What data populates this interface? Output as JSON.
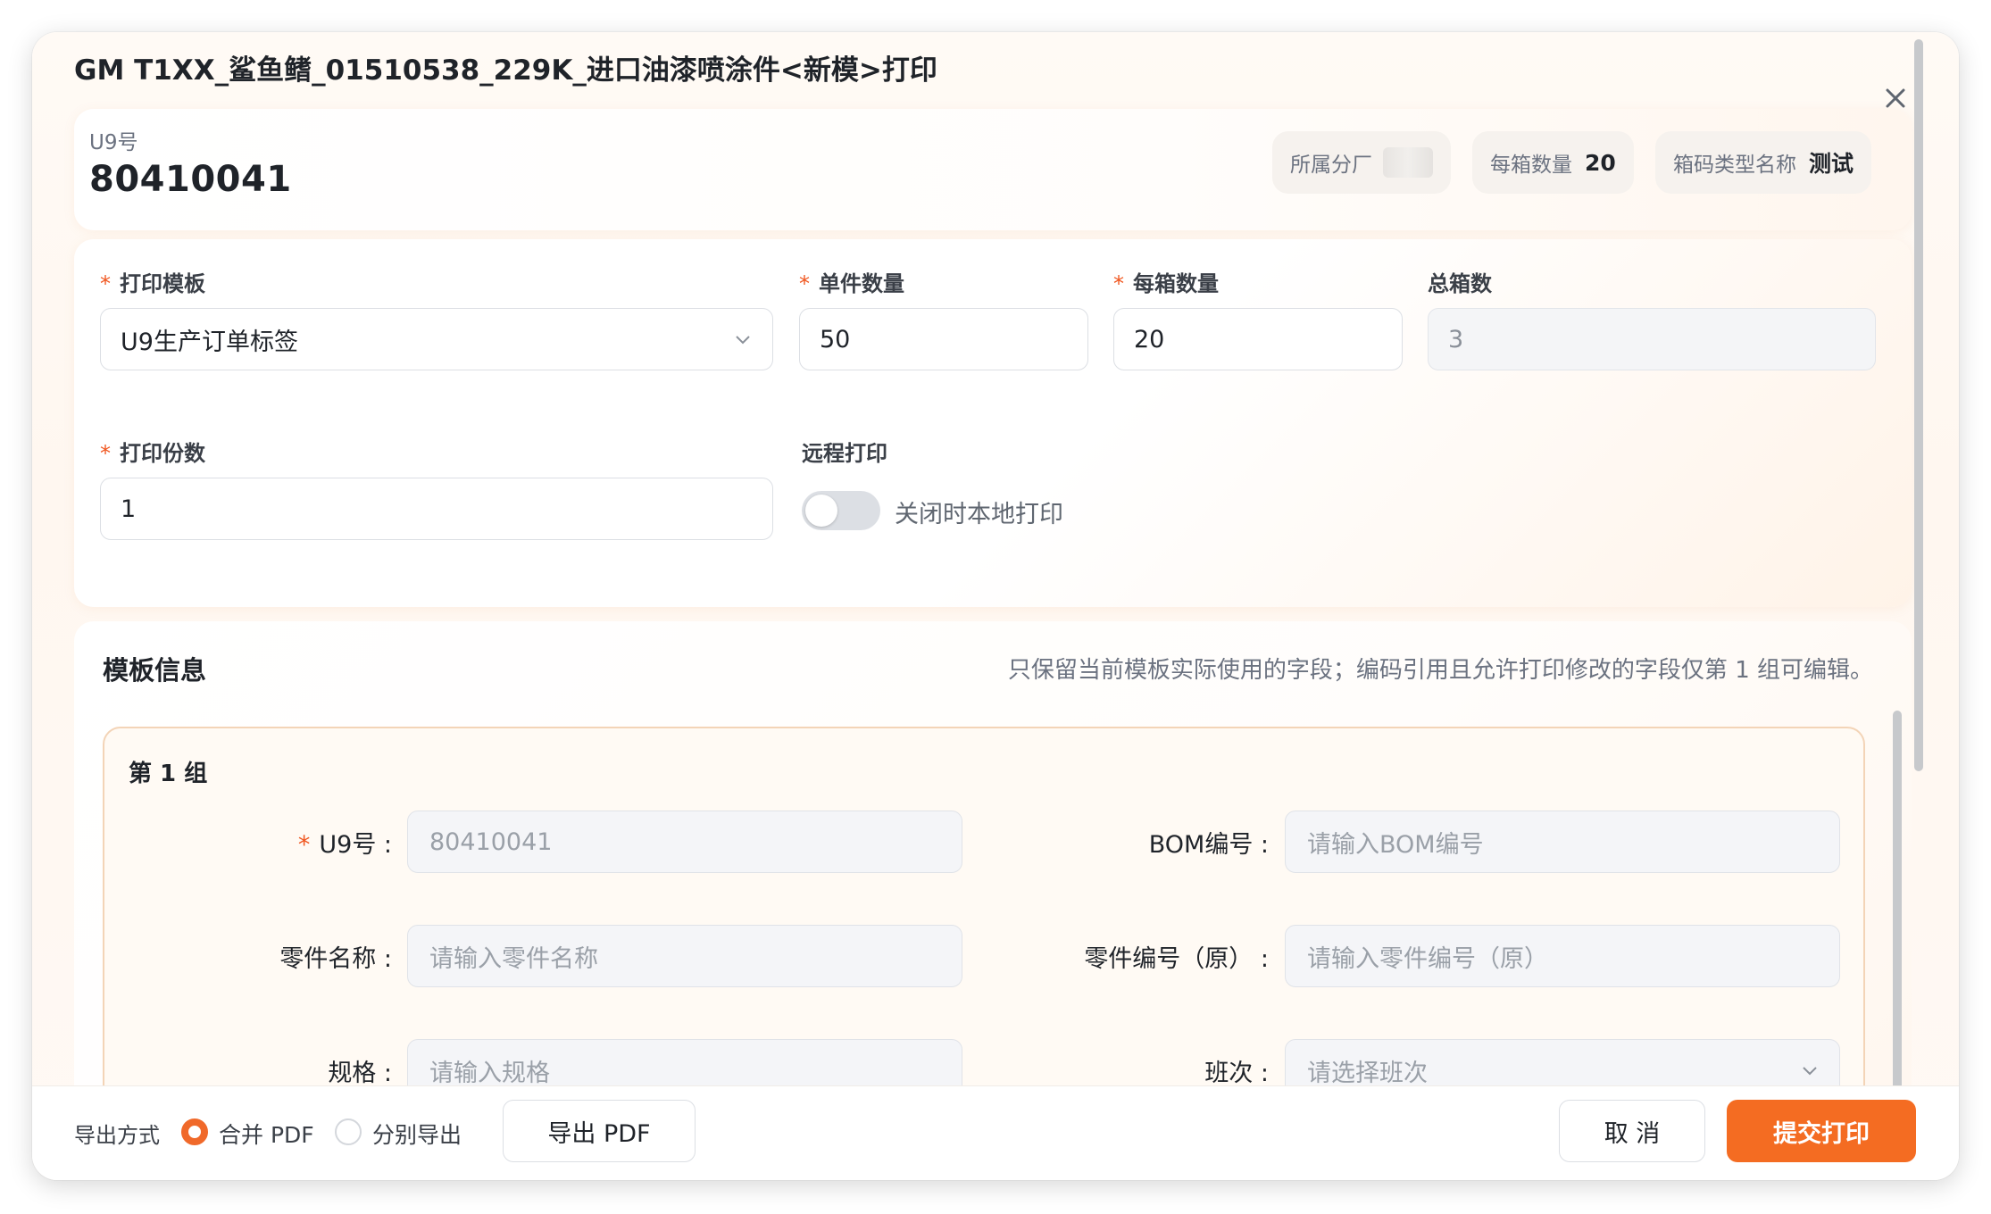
{
  "dialog": {
    "title": "GM T1XX_鲨鱼鳍_01510538_229K_进口油漆喷涂件<新模>打印"
  },
  "header": {
    "u9_label": "U9号",
    "u9_value": "80410041",
    "chips": [
      {
        "label": "所属分厂",
        "value": ""
      },
      {
        "label": "每箱数量",
        "value": "20"
      },
      {
        "label": "箱码类型名称",
        "value": "测试"
      }
    ]
  },
  "form": {
    "template_label": "打印模板",
    "template_value": "U9生产订单标签",
    "unit_qty_label": "单件数量",
    "unit_qty_value": "50",
    "box_qty_label": "每箱数量",
    "box_qty_value": "20",
    "total_box_label": "总箱数",
    "total_box_value": "3",
    "copies_label": "打印份数",
    "copies_value": "1",
    "remote_label": "远程打印",
    "remote_text": "关闭时本地打印",
    "required_mark": "*"
  },
  "template_info": {
    "title": "模板信息",
    "hint": "只保留当前模板实际使用的字段；编码引用且允许打印修改的字段仅第 1 组可编辑。",
    "group_title": "第 1 组",
    "fields": {
      "u9_label": "U9号 :",
      "u9_value": "80410041",
      "bom_label": "BOM编号 :",
      "bom_placeholder": "请输入BOM编号",
      "part_name_label": "零件名称 :",
      "part_name_placeholder": "请输入零件名称",
      "part_no_label": "零件编号（原） :",
      "part_no_placeholder": "请输入零件编号（原）",
      "spec_label": "规格 :",
      "spec_placeholder": "请输入规格",
      "shift_label": "班次 :",
      "shift_placeholder": "请选择班次"
    }
  },
  "footer": {
    "export_label": "导出方式",
    "merge_pdf": "合并 PDF",
    "separate": "分别导出",
    "export_btn": "导出 PDF",
    "cancel_btn": "取 消",
    "submit_btn": "提交打印"
  },
  "colors": {
    "accent": "#f46c22",
    "required": "#f0561f"
  }
}
